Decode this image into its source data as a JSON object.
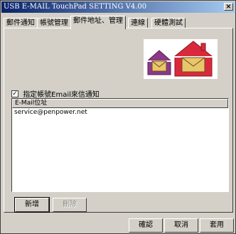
{
  "window": {
    "title": "USB E-MAIL TouchPad SETTING V4.00",
    "close_glyph": "×"
  },
  "tabs": [
    {
      "label": "郵件通知",
      "active": false
    },
    {
      "label": "帳號管理",
      "active": false
    },
    {
      "label": "郵件地址、管理",
      "active": true
    },
    {
      "label": "連線",
      "active": false
    },
    {
      "label": "硬體測試",
      "active": false
    }
  ],
  "icons": {
    "art": "envelope-houses-icon"
  },
  "colors": {
    "house_purple": "#8a3a86",
    "house_red": "#d82a3c",
    "envelope": "#e8c66a"
  },
  "filter": {
    "checkbox_checked": true,
    "checkbox_mark": "✓",
    "label": "指定帳號Email來信通知"
  },
  "list": {
    "column_header": "E-Mail位址",
    "items": [
      "service@penpower.net"
    ]
  },
  "buttons": {
    "add": "新增",
    "delete": "刪除",
    "ok": "確認",
    "cancel": "取消",
    "apply": "套用"
  }
}
